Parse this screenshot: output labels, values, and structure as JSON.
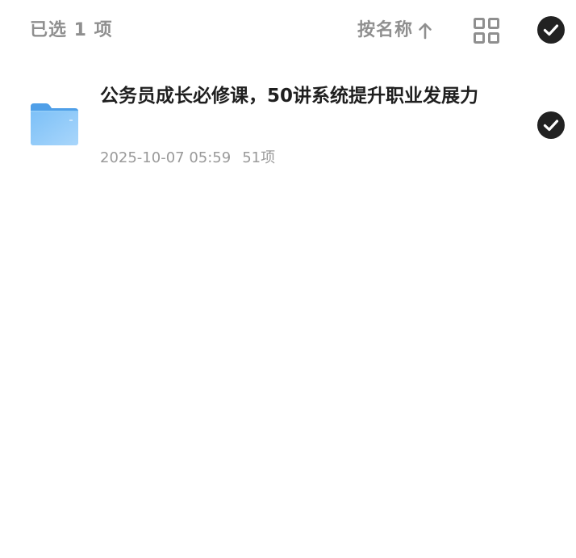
{
  "header": {
    "selected_count": "已选 1 项",
    "sort_label": "按名称",
    "sort_direction_icon": "arrow-up-icon",
    "view_toggle_icon": "grid-view-icon",
    "select_all_icon": "check-circle-icon"
  },
  "files": [
    {
      "name": "公务员成长必修课，50讲系统提升职业发展力",
      "modified": "2025-10-07 05:59",
      "item_count": "51项",
      "icon": "folder-icon",
      "selected": true
    }
  ],
  "colors": {
    "header_text": "#8f8f8f",
    "title_text": "#1f1f1f",
    "meta_text": "#9a9a9a",
    "check_fill": "#222222",
    "folder_blue": "#5aaaf0"
  }
}
